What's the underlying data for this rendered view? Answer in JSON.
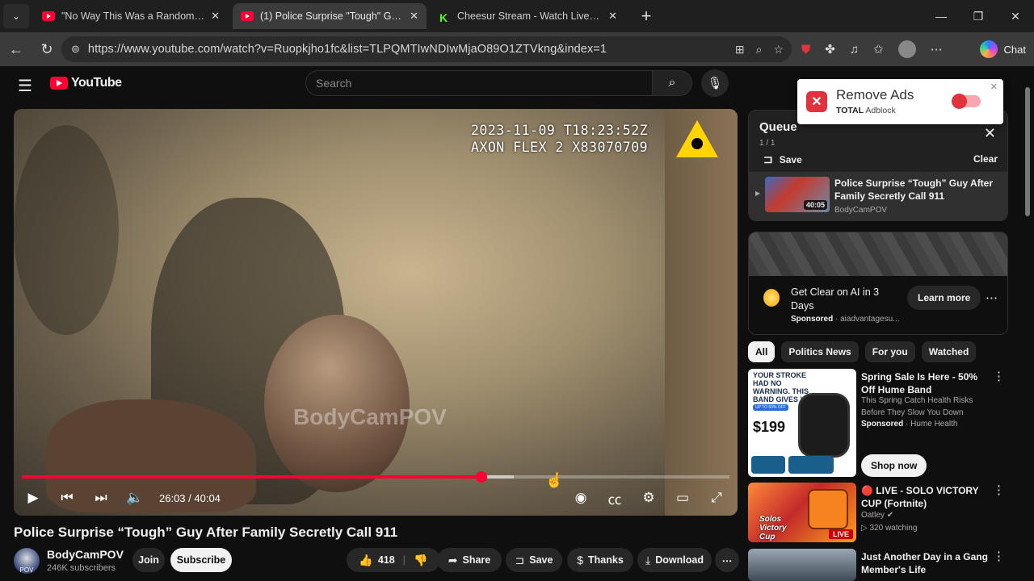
{
  "browser": {
    "tabs": [
      {
        "title": "\"No Way This Was a Random Traffi",
        "icon": "youtube-icon",
        "active": false
      },
      {
        "title": "(1) Police Surprise \"Tough\" Guy Af",
        "icon": "youtube-icon",
        "active": true
      },
      {
        "title": "Cheesur Stream - Watch Live on K",
        "icon": "kick-icon",
        "active": false
      }
    ],
    "url": "https://www.youtube.com/watch?v=Ruopkjho1fc&list=TLPQMTIwNDIwMjaO89O1ZTVkng&index=1",
    "chat_label": "Chat"
  },
  "yt": {
    "logo_text": "YouTube",
    "search_placeholder": "Search",
    "notification_count": "1"
  },
  "player": {
    "overlay_line1": "2023-11-09 T18:23:52Z",
    "overlay_line2": "AXON FLEX 2 X83070709",
    "watermark": "BodyCamPOV",
    "time": "26:03 / 40:04",
    "progress_fraction": 0.65,
    "buffer_fraction": 0.695
  },
  "video": {
    "title": "Police Surprise “Tough” Guy After Family Secretly Call 911",
    "channel": "BodyCamPOV",
    "subscribers": "246K subscribers",
    "avatar_text": "POV",
    "join": "Join",
    "subscribe": "Subscribe",
    "likes": "418",
    "share": "Share",
    "save": "Save",
    "thanks": "Thanks",
    "download": "Download"
  },
  "queue": {
    "title": "Queue",
    "count": "1 / 1",
    "save": "Save",
    "clear": "Clear",
    "item": {
      "title": "Police Surprise “Tough” Guy After Family Secretly Call 911",
      "channel": "BodyCamPOV",
      "duration": "40:05"
    }
  },
  "adblock": {
    "title": "Remove Ads",
    "brand_bold": "TOTAL",
    "brand": "Adblock"
  },
  "sponsored": {
    "title": "Get Clear on AI in 3 Days",
    "label": "Sponsored",
    "advertiser": "aiadvantagesu...",
    "cta": "Learn more"
  },
  "chips": [
    "All",
    "Politics News",
    "For you",
    "Watched"
  ],
  "recommendations": [
    {
      "title": "Spring Sale Is Here - 50% Off Hume Band",
      "desc": "This Spring Catch Health Risks Before They Slow You Down",
      "sponsored": "Sponsored",
      "advertiser": "Hume Health",
      "cta": "Shop now",
      "thumb_text1": "YOUR STROKE HAD NO WARNING. THIS BAND GIVES YOU ONE.",
      "thumb_price": "$199",
      "thumb_badge": "UP TO 50% OFF"
    },
    {
      "title": "🔴 LIVE - SOLO VICTORY CUP (Fortnite)",
      "channel": "Oatley",
      "meta": "320 watching",
      "live": "LIVE",
      "thumb_text": "Solos Victory Cup"
    },
    {
      "title": "Just Another Day in a Gang Member's Life"
    }
  ]
}
